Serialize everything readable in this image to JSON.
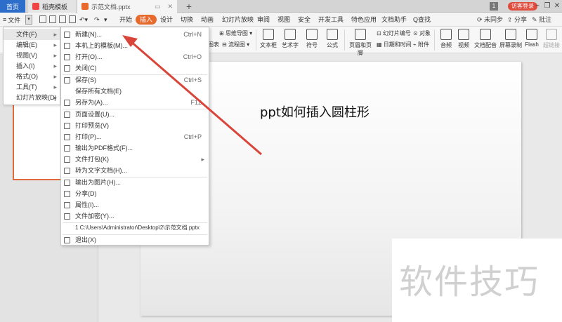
{
  "tabs": {
    "home": "首页",
    "template": "稻壳模板",
    "file": "示范文档.pptx",
    "add": "+"
  },
  "window": {
    "num": "1",
    "visitor": "访客登录",
    "min": "−",
    "max": "❐",
    "close": "✕"
  },
  "menu": {
    "file_label": "文件",
    "tabs": [
      "开始",
      "插入",
      "设计",
      "切换",
      "动画",
      "幻灯片放映",
      "审阅",
      "视图",
      "安全",
      "开发工具",
      "特色应用",
      "文档助手",
      "Q查找"
    ],
    "unsync": "未同步",
    "share": "分享",
    "comment": "批注"
  },
  "ribbon": {
    "mindmap": "思维导图",
    "flowchart": "流程图",
    "chart": "图表",
    "textbox": "文本框",
    "arttext": "艺术字",
    "symbol": "符号",
    "formula": "公式",
    "headerfooter": "页眉和页脚",
    "slidenum": "幻灯片编号",
    "datetime": "日期和时间",
    "object": "对象",
    "attach": "附件",
    "audio": "音频",
    "video": "视频",
    "docvoice": "文档配音",
    "record": "屏幕录制",
    "flash": "Flash",
    "hyperlink": "超链接"
  },
  "main_menu": [
    {
      "label": "文件(F)",
      "arrow": "▸"
    },
    {
      "label": "编辑(E)",
      "arrow": "▸"
    },
    {
      "label": "视图(V)",
      "arrow": "▸"
    },
    {
      "label": "插入(I)",
      "arrow": "▸"
    },
    {
      "label": "格式(O)",
      "arrow": "▸"
    },
    {
      "label": "工具(T)",
      "arrow": "▸"
    },
    {
      "label": "幻灯片放映(D)",
      "arrow": "▸"
    }
  ],
  "submenu": {
    "new": {
      "label": "新建(N)...",
      "shortcut": "Ctrl+N"
    },
    "local_template": {
      "label": "本机上的模板(M)..."
    },
    "open": {
      "label": "打开(O)...",
      "shortcut": "Ctrl+O"
    },
    "close": {
      "label": "关闭(C)"
    },
    "save": {
      "label": "保存(S)",
      "shortcut": "Ctrl+S"
    },
    "save_all": {
      "label": "保存所有文档(E)"
    },
    "save_as": {
      "label": "另存为(A)...",
      "shortcut": "F12"
    },
    "page_setup": {
      "label": "页面设置(U)..."
    },
    "print_preview": {
      "label": "打印预览(V)"
    },
    "print": {
      "label": "打印(P)...",
      "shortcut": "Ctrl+P"
    },
    "export_pdf": {
      "label": "输出为PDF格式(F)..."
    },
    "pack": {
      "label": "文件打包(K)",
      "arrow": "▸"
    },
    "to_text": {
      "label": "转为文字文档(H)..."
    },
    "export_image": {
      "label": "输出为图片(H)..."
    },
    "share": {
      "label": "分享(D)"
    },
    "properties": {
      "label": "属性(I)..."
    },
    "encrypt": {
      "label": "文件加密(Y)..."
    },
    "recent": {
      "label": "1 C:\\Users\\Administrator\\Desktop\\2\\示范文档.pptx"
    },
    "exit": {
      "label": "退出(X)"
    }
  },
  "slide": {
    "title": "ppt如何插入圆柱形"
  },
  "watermark": "软件技巧",
  "colors": {
    "accent": "#e8692c",
    "arrow": "#d9453a",
    "home_tab": "#2d6ecb"
  }
}
